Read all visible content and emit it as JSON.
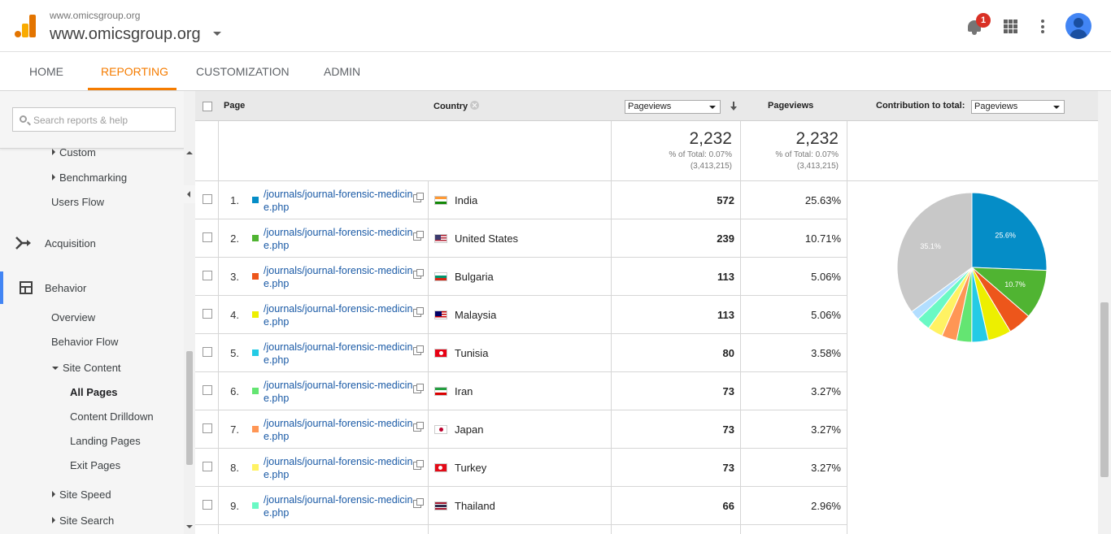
{
  "header": {
    "account_small": "www.omicsgroup.org",
    "account_big": "www.omicsgroup.org",
    "notification_count": "1",
    "brand_color": "#f57c00"
  },
  "nav": {
    "tabs": [
      {
        "label": "HOME",
        "active": false
      },
      {
        "label": "REPORTING",
        "active": true
      },
      {
        "label": "CUSTOMIZATION",
        "active": false
      },
      {
        "label": "ADMIN",
        "active": false
      }
    ]
  },
  "sidebar": {
    "search_placeholder": "Search reports & help",
    "custom": "Custom",
    "benchmarking": "Benchmarking",
    "users_flow": "Users Flow",
    "acquisition": "Acquisition",
    "behavior": "Behavior",
    "overview": "Overview",
    "behavior_flow": "Behavior Flow",
    "site_content": "Site Content",
    "all_pages": "All Pages",
    "content_drilldown": "Content Drilldown",
    "landing_pages": "Landing Pages",
    "exit_pages": "Exit Pages",
    "site_speed": "Site Speed",
    "site_search": "Site Search"
  },
  "table": {
    "col_page": "Page",
    "col_country": "Country",
    "metric_select": "Pageviews",
    "col_pageviews": "Pageviews",
    "contribution_label": "Contribution to total:",
    "contribution_select": "Pageviews",
    "totals": {
      "value1": "2,232",
      "pct1": "% of Total: 0.07%",
      "total1": "(3,413,215)",
      "value2": "2,232",
      "pct2": "% of Total: 0.07%",
      "total2": "(3,413,215)"
    },
    "rows": [
      {
        "num": "1.",
        "page": "/journals/journal-forensic-medicine.php",
        "country": "India",
        "flag": "india",
        "pageviews": "572",
        "percent": "25.63%",
        "color": "#058dc7"
      },
      {
        "num": "2.",
        "page": "/journals/journal-forensic-medicine.php",
        "country": "United States",
        "flag": "usa",
        "pageviews": "239",
        "percent": "10.71%",
        "color": "#50b432"
      },
      {
        "num": "3.",
        "page": "/journals/journal-forensic-medicine.php",
        "country": "Bulgaria",
        "flag": "bulgaria",
        "pageviews": "113",
        "percent": "5.06%",
        "color": "#ed561b"
      },
      {
        "num": "4.",
        "page": "/journals/journal-forensic-medicine.php",
        "country": "Malaysia",
        "flag": "malaysia",
        "pageviews": "113",
        "percent": "5.06%",
        "color": "#edef00"
      },
      {
        "num": "5.",
        "page": "/journals/journal-forensic-medicine.php",
        "country": "Tunisia",
        "flag": "tunisia",
        "pageviews": "80",
        "percent": "3.58%",
        "color": "#24cbe5"
      },
      {
        "num": "6.",
        "page": "/journals/journal-forensic-medicine.php",
        "country": "Iran",
        "flag": "iran",
        "pageviews": "73",
        "percent": "3.27%",
        "color": "#64e572"
      },
      {
        "num": "7.",
        "page": "/journals/journal-forensic-medicine.php",
        "country": "Japan",
        "flag": "japan",
        "pageviews": "73",
        "percent": "3.27%",
        "color": "#ff9655"
      },
      {
        "num": "8.",
        "page": "/journals/journal-forensic-medicine.php",
        "country": "Turkey",
        "flag": "turkey",
        "pageviews": "73",
        "percent": "3.27%",
        "color": "#fff263"
      },
      {
        "num": "9.",
        "page": "/journals/journal-forensic-medicine.php",
        "country": "Thailand",
        "flag": "thailand",
        "pageviews": "66",
        "percent": "2.96%",
        "color": "#6af9c4"
      }
    ]
  },
  "chart_data": {
    "type": "pie",
    "slices": [
      {
        "label": "25.6%",
        "value": 25.63,
        "color": "#058dc7"
      },
      {
        "label": "10.7%",
        "value": 10.71,
        "color": "#50b432"
      },
      {
        "label": "",
        "value": 5.06,
        "color": "#ed561b"
      },
      {
        "label": "",
        "value": 5.06,
        "color": "#edef00"
      },
      {
        "label": "",
        "value": 3.58,
        "color": "#24cbe5"
      },
      {
        "label": "",
        "value": 3.27,
        "color": "#64e572"
      },
      {
        "label": "",
        "value": 3.27,
        "color": "#ff9655"
      },
      {
        "label": "",
        "value": 3.27,
        "color": "#fff263"
      },
      {
        "label": "",
        "value": 2.96,
        "color": "#6af9c4"
      },
      {
        "label": "",
        "value": 2.1,
        "color": "#b2deff"
      },
      {
        "label": "35.1%",
        "value": 35.09,
        "color": "#c8c8c8"
      }
    ]
  }
}
